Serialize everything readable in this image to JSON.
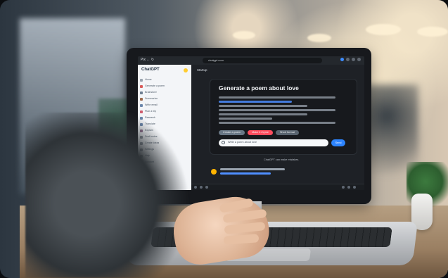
{
  "topbar": {
    "window_controls": "Pix ← ↻",
    "address": "chatgpt.com"
  },
  "sidebar": {
    "brand": "ChatGPT",
    "items": [
      {
        "label": "Home"
      },
      {
        "label": "Generate a poem"
      },
      {
        "label": "Brainstorm"
      },
      {
        "label": "Summarize"
      },
      {
        "label": "Write email"
      },
      {
        "label": "Plan a trip"
      },
      {
        "label": "Research"
      },
      {
        "label": "Translate"
      },
      {
        "label": "Explain"
      },
      {
        "label": "Draft notes"
      },
      {
        "label": "Create ideas"
      },
      {
        "label": "Settings"
      },
      {
        "label": "Help"
      },
      {
        "label": "Account"
      }
    ]
  },
  "main": {
    "tab_label": "Startup",
    "card_title": "Generate a poem about love",
    "pills": [
      {
        "label": "Create a poem"
      },
      {
        "label": "Make it rhyme"
      },
      {
        "label": "Short format"
      }
    ],
    "prompt_text": "Write a poem about love",
    "send_label": "Send",
    "footer_note": "ChatGPT can make mistakes."
  },
  "colors": {
    "accent_blue": "#2d84ff",
    "accent_red": "#ff4d5e",
    "accent_yellow": "#ffcc2f"
  }
}
